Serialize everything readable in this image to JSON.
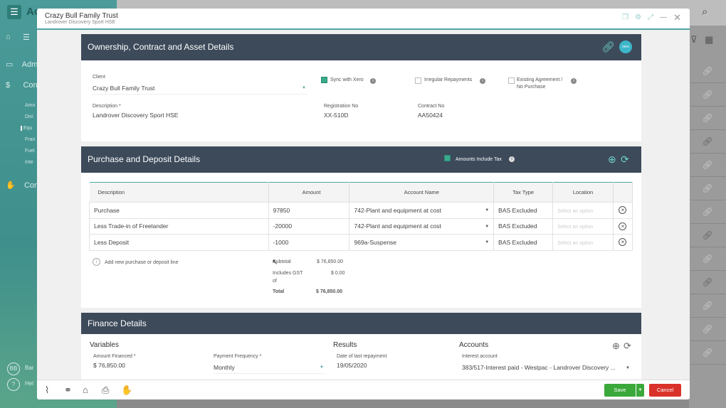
{
  "background": {
    "app_title": "Ac",
    "nav": [
      {
        "label": "Adm"
      },
      {
        "label": "Con"
      },
      {
        "label": "Con"
      }
    ],
    "sub_items": [
      "Amo",
      "Divi",
      "Equ",
      "Fran",
      "Fuel",
      "Inte"
    ],
    "footer_items": [
      {
        "badge": "BB",
        "label": "Bar"
      },
      {
        "badge": "?",
        "label": "Hel"
      }
    ]
  },
  "modal": {
    "title": "Crazy Bull Family Trust",
    "subtitle": "Landrover Discovery Sport HSE"
  },
  "ownership": {
    "heading": "Ownership, Contract and Asset Details",
    "client_label": "Client",
    "client_value": "Crazy Bull Family Trust",
    "sync_label": "Sync with Xero",
    "sync_checked": true,
    "irregular_label": "Irregular Repayments",
    "existing_label_1": "Existing Agreement /",
    "existing_label_2": "No Purchase",
    "description_label": "Description *",
    "description_value": "Landrover Discovery Sport HSE",
    "registration_label": "Registration No",
    "registration_value": "XX-510D",
    "contract_label": "Contract No",
    "contract_value": "AA50424",
    "xero_badge": "xero"
  },
  "purchase": {
    "heading": "Purchase and Deposit Details",
    "amounts_tax_label": "Amounts Include Tax",
    "columns": [
      "Description",
      "Amount",
      "Account Name",
      "Tax Type",
      "Location"
    ],
    "rows": [
      {
        "description": "Purchase",
        "amount": "97850",
        "account": "742-Plant and equipment at cost",
        "tax": "BAS Excluded",
        "location": "Select an option"
      },
      {
        "description": "Less Trade-in of Freelander",
        "amount": "-20000",
        "account": "742-Plant and equipment at cost",
        "tax": "BAS Excluded",
        "location": "Select an option"
      },
      {
        "description": "Less Deposit",
        "amount": "-1000",
        "account": "969a-Suspense",
        "tax": "BAS Excluded",
        "location": "Select an option"
      }
    ],
    "add_line": "Add new purchase or deposit line",
    "subtotal_label": "Subtotal",
    "subtotal_value": "$ 76,850.00",
    "gst_label_1": "Includes GST",
    "gst_label_2": "of",
    "gst_value": "$ 0.00",
    "total_label": "Total",
    "total_value": "$ 76,850.00"
  },
  "finance": {
    "heading": "Finance Details",
    "variables_title": "Variables",
    "amount_financed_label": "Amount Financed *",
    "amount_financed_value": "$ 76,850.00",
    "payment_frequency_label": "Payment Frequency *",
    "payment_frequency_value": "Monthly",
    "results_title": "Results",
    "last_repayment_label": "Date of last repayment",
    "last_repayment_value": "19/05/2020",
    "accounts_title": "Accounts",
    "interest_account_label": "Interest account",
    "interest_account_value": "383/517-Interest paid - Westpac - Landrover Discovery ..."
  },
  "footer": {
    "save_label": "Save",
    "cancel_label": "Cancel"
  },
  "colors": {
    "accent": "#4fa7a4",
    "panel_header": "#3d4a5a",
    "save": "#3aa83a",
    "cancel": "#d9322b"
  }
}
